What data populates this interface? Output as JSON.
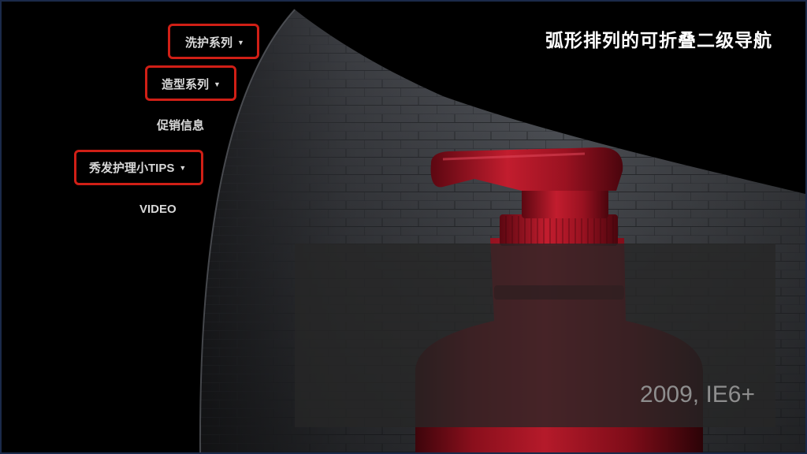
{
  "page": {
    "title": "弧形排列的可折叠二级导航",
    "caption": "2009, IE6+"
  },
  "nav": {
    "items": [
      {
        "label": "洗护系列",
        "has_submenu": true,
        "highlighted": true
      },
      {
        "label": "造型系列",
        "has_submenu": true,
        "highlighted": true
      },
      {
        "label": "促销信息",
        "has_submenu": false,
        "highlighted": false
      },
      {
        "label": "秀发护理小TIPS",
        "has_submenu": true,
        "highlighted": true
      },
      {
        "label": "VIDEO",
        "has_submenu": false,
        "highlighted": false
      }
    ],
    "caret_glyph": "▼"
  },
  "colors": {
    "background": "#000000",
    "highlight_border": "#d01f16",
    "bottle_red": "#8a0f1c",
    "wall_gray": "#4a4d52",
    "nav_text": "#d9d9d9",
    "caption_text": "#8e8e8e"
  },
  "icons": {
    "submenu_indicator": "caret-down-icon"
  }
}
